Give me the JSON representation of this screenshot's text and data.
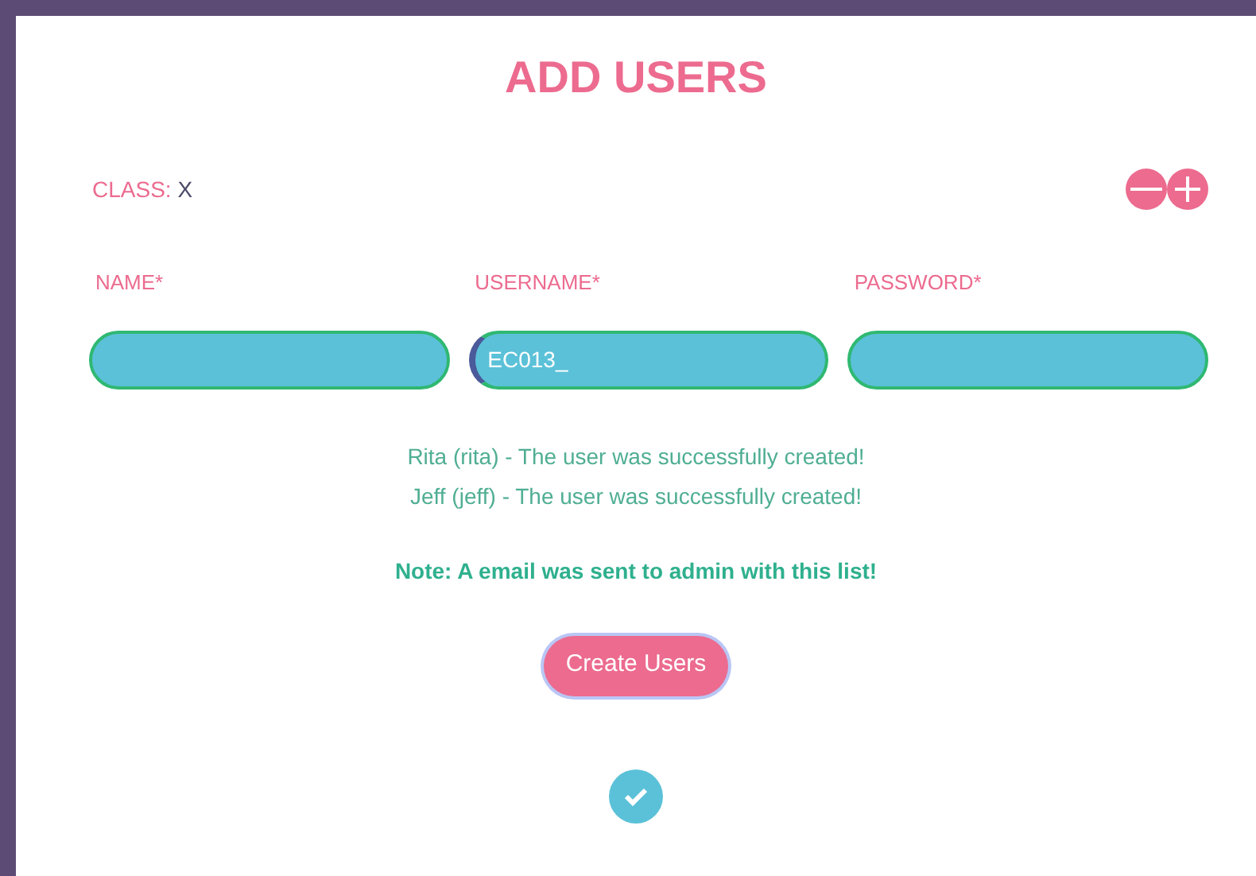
{
  "title": "ADD USERS",
  "class": {
    "label": "CLASS:",
    "value": "X"
  },
  "fields": [
    {
      "label": "NAME*",
      "focused": false
    },
    {
      "label": "USERNAME*",
      "value": "EC013_",
      "focused": true
    },
    {
      "label": "PASSWORD*",
      "focused": false
    }
  ],
  "messages": [
    "Rita (rita) - The user was successfully created!",
    "Jeff (jeff) - The user was successfully created!"
  ],
  "note": "Note: A email was sent to admin with this list!",
  "button": "Create Users"
}
